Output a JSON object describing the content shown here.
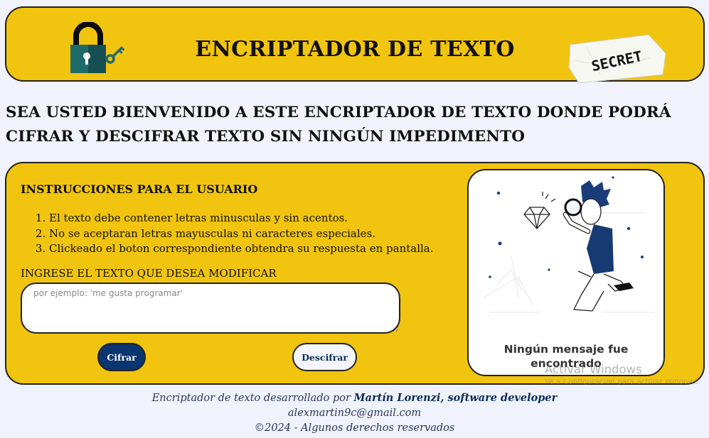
{
  "header": {
    "title": "ENCRIPTADOR DE TEXTO",
    "logo_icon": "padlock-key-icon",
    "badge_text": "SECRET"
  },
  "welcome": "SEA USTED BIENVENIDO A ESTE ENCRIPTADOR DE TEXTO DONDE PODRÁ CIFRAR Y DESCIFRAR TEXTO SIN NINGÚN IMPEDIMENTO",
  "instructions": {
    "title": "INSTRUCCIONES PARA EL USUARIO",
    "items": [
      "El texto debe contener letras minusculas y sin acentos.",
      "No se aceptaran letras mayusculas ni caracteres especiales.",
      "Clickeado el boton correspondiente obtendra su respuesta en pantalla."
    ]
  },
  "input": {
    "label": "INGRESE EL TEXTO QUE DESEA MODIFICAR",
    "placeholder": "por ejemplo: 'me gusta programar'",
    "value": ""
  },
  "buttons": {
    "encrypt": "Cifrar",
    "decrypt": "Descifrar"
  },
  "result": {
    "illustration_icon": "person-with-magnifier-icon",
    "message": "Ningún mensaje fue encontrado"
  },
  "watermark": {
    "title": "Activar Windows",
    "subtitle": "Ve a Configuración para activar Windows."
  },
  "footer": {
    "credit_prefix": "Encriptador de texto desarrollado por ",
    "credit_name": "Martín Lorenzi, software developer",
    "email": "alexmartin9c@gmail.com",
    "copyright": "©2024 - Algunos derechos reservados"
  },
  "colors": {
    "background": "#f1f3fc",
    "accent": "#f1c40f",
    "primary_button": "#0a3570",
    "text_dark": "#111111"
  }
}
